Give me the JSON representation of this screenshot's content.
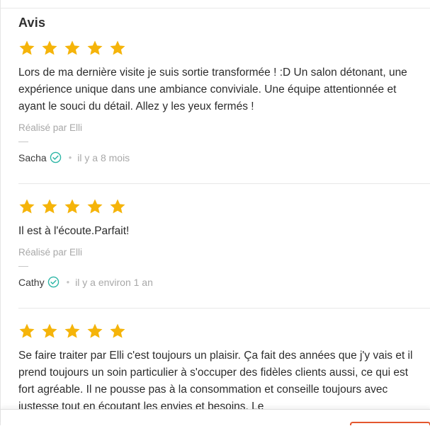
{
  "section": {
    "title": "Avis"
  },
  "colors": {
    "star": "#f5b40a",
    "verified": "#2bb5a5",
    "cta": "#e4572e"
  },
  "icons": {
    "rating": "star-icon",
    "verified": "verified-check-icon"
  },
  "reviews": [
    {
      "rating": 5,
      "text": "Lors de ma dernière visite je suis sortie transformée ! :D Un salon détonant, une expérience unique dans une ambiance conviviale. Une équipe attentionnée et ayant le souci du détail. Allez y les yeux fermés !",
      "service": "Réalisé par Elli",
      "author": "Sacha",
      "date": "il y a 8 mois"
    },
    {
      "rating": 5,
      "text": "Il est à l'écoute.Parfait!",
      "service": "Réalisé par Elli",
      "author": "Cathy",
      "date": "il y a environ 1 an"
    },
    {
      "rating": 5,
      "text": "Se faire traiter par Elli c'est toujours un plaisir. Ça fait des années que j'y vais et il prend toujours un soin particulier à s'occuper des fidèles clients aussi, ce qui est fort agréable. Il ne pousse pas à la consommation et conseille toujours avec justesse tout en écoutant les envies et besoins. Le"
    }
  ]
}
